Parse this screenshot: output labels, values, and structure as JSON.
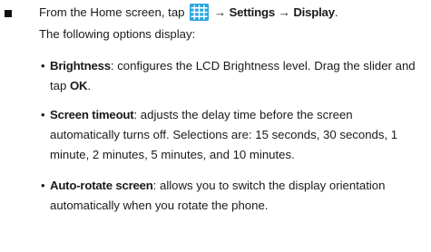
{
  "step": {
    "pre": "From the Home screen, tap",
    "arrow1": "→",
    "settings": "Settings",
    "arrow2": "→",
    "display": "Display",
    "period": ".",
    "icon": "apps-grid-icon",
    "icon_color": "#2aa7df"
  },
  "intro": "The following options display:",
  "options": [
    {
      "term": "Brightness",
      "text": ": configures the LCD Brightness level. Drag the slider and tap ",
      "bold_tail": "OK",
      "tail": "."
    },
    {
      "term": "Screen timeout",
      "text": ": adjusts the delay time before the screen automatically turns off. Selections are: 15 seconds, 30 seconds, 1 minute, 2 minutes, 5 minutes, and 10 minutes."
    },
    {
      "term": "Auto-rotate screen",
      "text": ": allows you to switch the display orientation automatically when you rotate the phone."
    }
  ]
}
